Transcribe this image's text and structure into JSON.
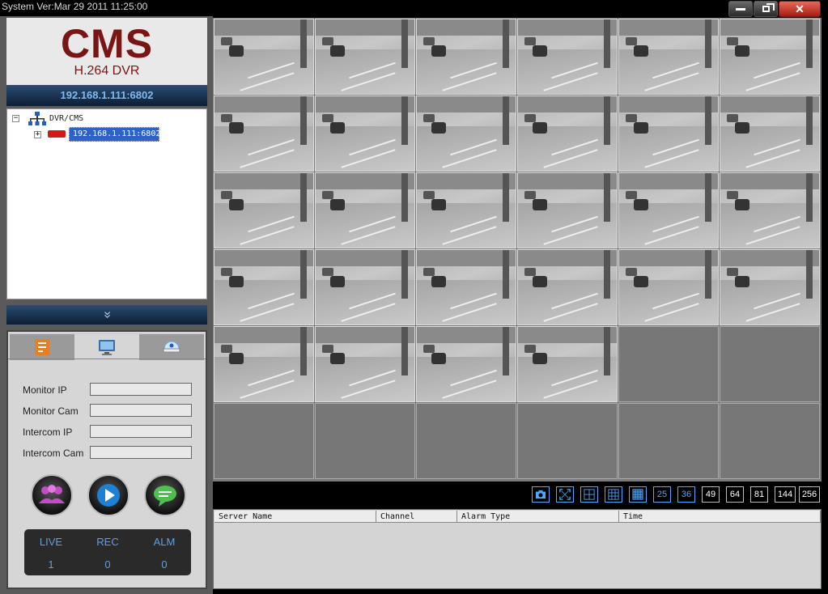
{
  "window": {
    "title": "System Ver:Mar 29 2011 11:25:00",
    "close_glyph": "✕"
  },
  "logo": {
    "main": "CMS",
    "sub": "H.264 DVR"
  },
  "device_header": "192.168.1.111:6802",
  "tree": {
    "root": "DVR/CMS",
    "child": "192.168.1.111:6802",
    "root_expander": "−",
    "child_expander": "+"
  },
  "collapse_glyph": "»",
  "panel": {
    "fields": [
      {
        "label": "Monitor IP",
        "value": ""
      },
      {
        "label": "Monitor Cam",
        "value": ""
      },
      {
        "label": "Intercom IP",
        "value": ""
      },
      {
        "label": "Intercom Cam",
        "value": ""
      }
    ],
    "status": [
      {
        "label": "LIVE",
        "value": "1"
      },
      {
        "label": "REC",
        "value": "0"
      },
      {
        "label": "ALM",
        "value": "0"
      }
    ]
  },
  "video": {
    "active_feeds": 28,
    "total_cells": 36,
    "columns": 6
  },
  "toolbar": {
    "layouts": [
      "25",
      "36",
      "49",
      "64",
      "81",
      "144",
      "256"
    ],
    "active_layouts": [
      "25",
      "36"
    ]
  },
  "alarm_table": {
    "columns": [
      "Server Name",
      "Channel",
      "Alarm Type",
      "Time"
    ]
  },
  "colors": {
    "logo": "#7a1515",
    "accent": "#4fa8ff",
    "selection": "#2f62c9",
    "close": "#c0392b"
  },
  "icons": [
    "minimize-icon",
    "maximize-icon",
    "close-icon",
    "network-tree-icon",
    "dvr-device-icon",
    "device-config-icon",
    "monitor-icon",
    "camera-dome-icon",
    "intercom-group-icon",
    "play-icon",
    "chat-icon",
    "snapshot-icon",
    "fullscreen-icon",
    "layout-4-icon",
    "layout-9-icon",
    "layout-16-icon"
  ]
}
